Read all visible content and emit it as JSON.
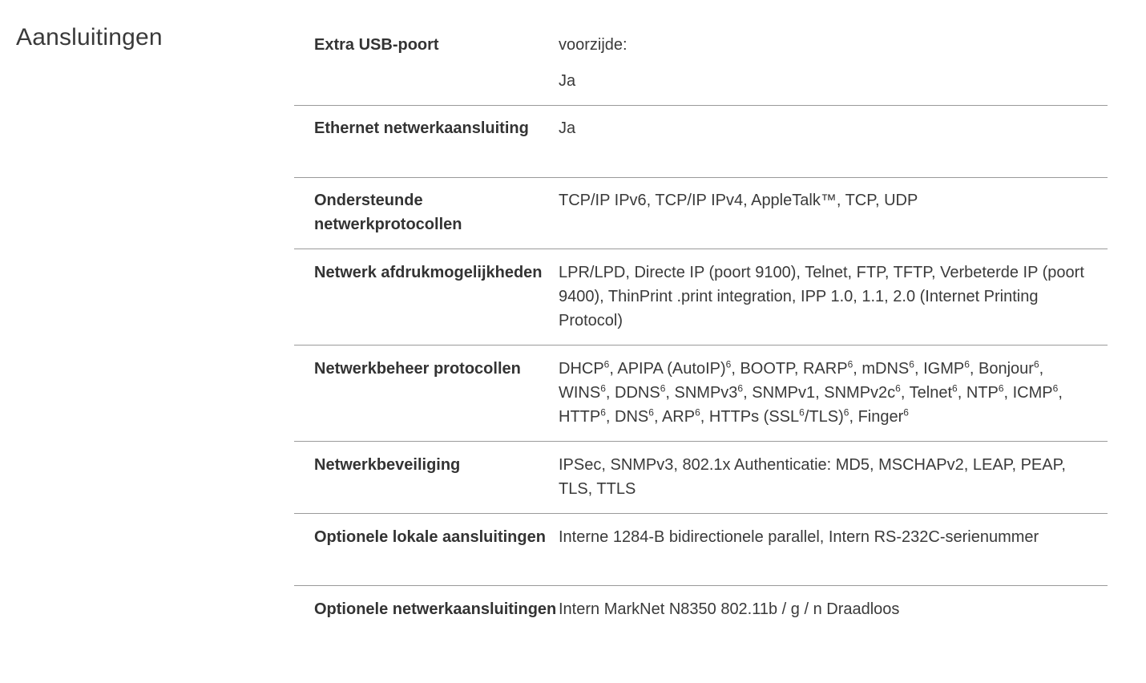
{
  "section": {
    "title": "Aansluitingen"
  },
  "rows": [
    {
      "label": "Extra USB-poort",
      "value_line1": "voorzijde:",
      "value_line2": "Ja"
    },
    {
      "label": "Ethernet netwerkaansluiting",
      "value": "Ja"
    },
    {
      "label": "Ondersteunde netwerkprotocollen",
      "value": "TCP/IP IPv6, TCP/IP IPv4, AppleTalk™, TCP, UDP"
    },
    {
      "label": "Netwerk afdrukmogelijkheden",
      "value": "LPR/LPD, Directe IP (poort 9100), Telnet, FTP, TFTP, Verbeterde IP (poort 9400), ThinPrint .print integration, IPP 1.0, 1.1, 2.0 (Internet Printing Protocol)"
    },
    {
      "label": "Netwerkbeheer protocollen",
      "value_items": [
        {
          "text": "DHCP",
          "sup": "6",
          "after": ", "
        },
        {
          "text": "APIPA (AutoIP)",
          "sup": "6",
          "after": ", "
        },
        {
          "text": "BOOTP, RARP",
          "sup": "6",
          "after": ", "
        },
        {
          "text": "mDNS",
          "sup": "6",
          "after": ", "
        },
        {
          "text": "IGMP",
          "sup": "6",
          "after": ", "
        },
        {
          "text": "Bonjour",
          "sup": "6",
          "after": ", "
        },
        {
          "text": "WINS",
          "sup": "6",
          "after": ", "
        },
        {
          "text": "DDNS",
          "sup": "6",
          "after": ", "
        },
        {
          "text": "SNMPv3",
          "sup": "6",
          "after": ", "
        },
        {
          "text": "SNMPv1, SNMPv2c",
          "sup": "6",
          "after": ", "
        },
        {
          "text": "Telnet",
          "sup": "6",
          "after": ", "
        },
        {
          "text": "NTP",
          "sup": "6",
          "after": ", "
        },
        {
          "text": "ICMP",
          "sup": "6",
          "after": ", "
        },
        {
          "text": "HTTP",
          "sup": "6",
          "after": ", "
        },
        {
          "text": "DNS",
          "sup": "6",
          "after": ", "
        },
        {
          "text": "ARP",
          "sup": "6",
          "after": ", "
        },
        {
          "text": "HTTPs (SSL",
          "sup": "6",
          "after": ""
        },
        {
          "text": "/TLS)",
          "sup": "6",
          "after": ", "
        },
        {
          "text": "Finger",
          "sup": "6",
          "after": ""
        }
      ]
    },
    {
      "label": "Netwerkbeveiliging",
      "value": "IPSec, SNMPv3, 802.1x Authenticatie: MD5, MSCHAPv2, LEAP, PEAP, TLS, TTLS"
    },
    {
      "label": "Optionele lokale aansluitingen",
      "value": "Interne 1284-B bidirectionele parallel, Intern RS-232C-serienummer"
    },
    {
      "label": "Optionele netwerkaansluitingen",
      "value": "Intern MarkNet N8350 802.11b / g / n Draadloos"
    }
  ]
}
